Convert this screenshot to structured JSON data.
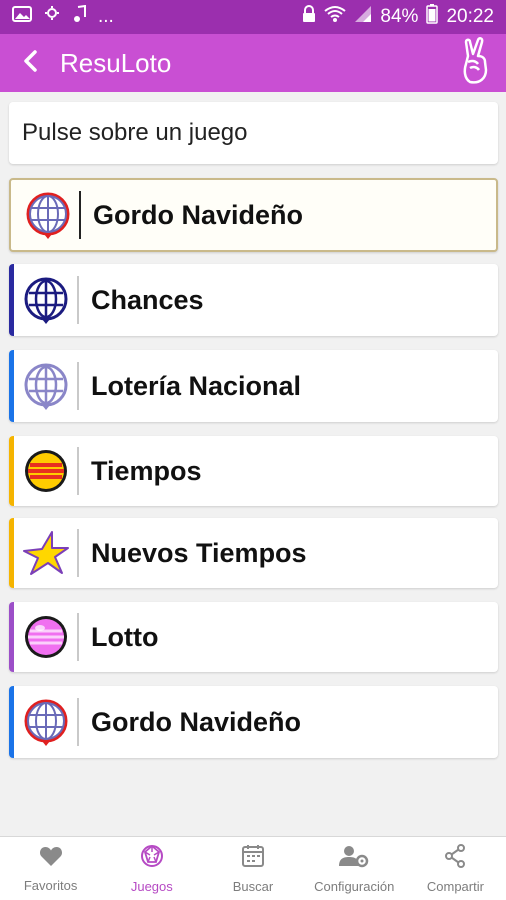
{
  "status_bar": {
    "battery": "84%",
    "time": "20:22",
    "extra": "..."
  },
  "app_bar": {
    "title": "ResuLoto"
  },
  "prompt": "Pulse sobre un juego",
  "games": [
    {
      "label": "Gordo Navideño",
      "stripe": "",
      "logo": "globe-red-icon",
      "selected": true
    },
    {
      "label": "Chances",
      "stripe": "#2a2aa0",
      "logo": "globe-navy-icon"
    },
    {
      "label": "Lotería Nacional",
      "stripe": "#1a73e8",
      "logo": "globe-lavender-icon"
    },
    {
      "label": "Tiempos",
      "stripe": "#f5b400",
      "logo": "sun-ball-icon"
    },
    {
      "label": "Nuevos Tiempos",
      "stripe": "#f5b400",
      "logo": "star-icon"
    },
    {
      "label": "Lotto",
      "stripe": "#9c4fc8",
      "logo": "pink-ball-icon"
    },
    {
      "label": "Gordo Navideño",
      "stripe": "#1a73e8",
      "logo": "globe-red-icon"
    }
  ],
  "bottom_nav": [
    {
      "label": "Favoritos",
      "icon": "heart-icon"
    },
    {
      "label": "Juegos",
      "icon": "lottery-ball-icon",
      "active": true
    },
    {
      "label": "Buscar",
      "icon": "calendar-icon"
    },
    {
      "label": "Configuración",
      "icon": "user-settings-icon"
    },
    {
      "label": "Compartir",
      "icon": "share-icon"
    }
  ],
  "colors": {
    "status_bar": "#9b2fae",
    "app_bar": "#c94fd3",
    "active_nav": "#b64ac4"
  }
}
